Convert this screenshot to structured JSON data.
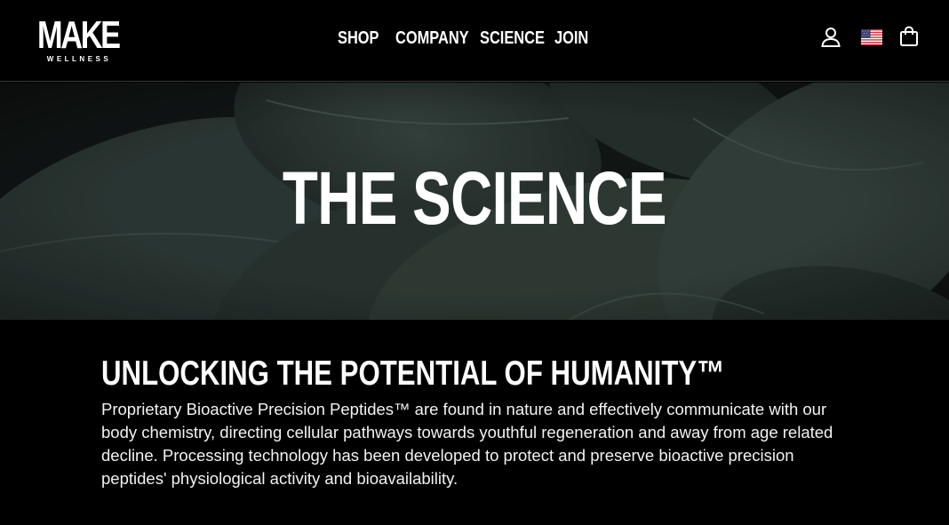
{
  "header": {
    "logo": {
      "main": "MAKE",
      "sub": "WELLNESS"
    },
    "nav": [
      {
        "label": "SHOP"
      },
      {
        "label": "COMPANY"
      },
      {
        "label": "SCIENCE"
      },
      {
        "label": "JOIN"
      }
    ],
    "icons": [
      "account-icon",
      "us-flag-icon",
      "shopping-bag-icon"
    ]
  },
  "hero": {
    "title": "THE SCIENCE"
  },
  "section": {
    "heading": "UNLOCKING THE POTENTIAL OF HUMANITY™",
    "body": "Proprietary Bioactive Precision Peptides™ are found in nature and effectively communicate with our body chemistry, directing cellular pathways towards youthful regeneration and away from age related decline. Processing technology has been developed to protect and preserve bioactive precision peptides' physiological activity and bioavailability."
  },
  "colors": {
    "background": "#000000",
    "text": "#ffffff",
    "leaf": "#2d3a36"
  }
}
